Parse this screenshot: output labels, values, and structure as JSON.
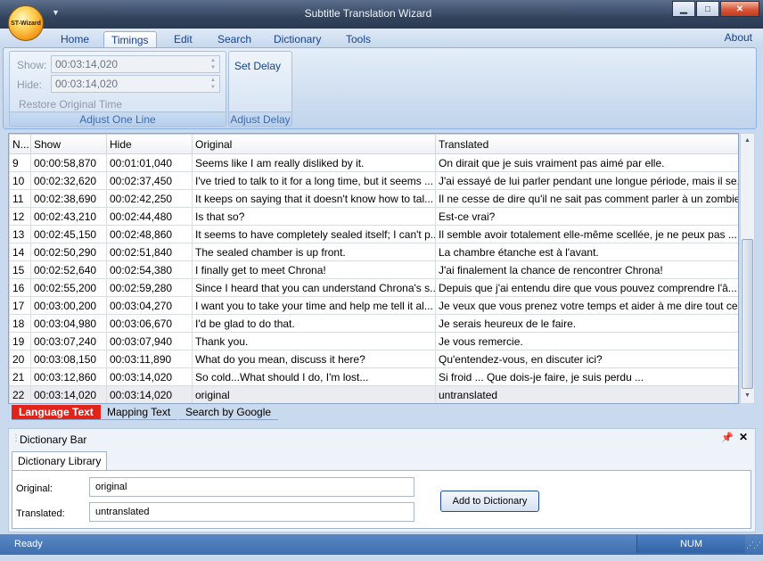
{
  "window": {
    "title": "Subtitle Translation Wizard",
    "orb_label": "ST-Wizard",
    "minimize": "▁",
    "maximize": "□",
    "close": "✕"
  },
  "ribbon_tabs": [
    "Home",
    "Timings",
    "Edit",
    "Search",
    "Dictionary",
    "Tools"
  ],
  "active_tab": "Timings",
  "about_label": "About",
  "adjust_one_line": {
    "show_label": "Show:",
    "show_value": "00:03:14,020",
    "hide_label": "Hide:",
    "hide_value": "00:03:14,020",
    "restore_label": "Restore Original Time",
    "group_label": "Adjust One Line"
  },
  "adjust_delay": {
    "set_delay_label": "Set Delay",
    "group_label": "Adjust Delay"
  },
  "grid": {
    "columns": [
      "N...",
      "Show",
      "Hide",
      "Original",
      "Translated"
    ],
    "rows": [
      [
        "9",
        "00:00:58,870",
        "00:01:01,040",
        "Seems like I am really disliked by it.",
        "On dirait que je suis vraiment pas aimé par elle."
      ],
      [
        "10",
        "00:02:32,620",
        "00:02:37,450",
        "I've tried to talk to it for a long time, but it seems ...",
        "J'ai essayé de lui parler pendant une longue période, mais il se..."
      ],
      [
        "11",
        "00:02:38,690",
        "00:02:42,250",
        "It keeps on saying that it doesn't know how to tal...",
        "Il ne cesse de dire qu'il ne sait pas comment parler à un zombie."
      ],
      [
        "12",
        "00:02:43,210",
        "00:02:44,480",
        "Is that so?",
        "Est-ce vrai?"
      ],
      [
        "13",
        "00:02:45,150",
        "00:02:48,860",
        "It seems to have completely sealed itself; I can't p...",
        "Il semble avoir totalement elle-même scellée, je ne peux pas ..."
      ],
      [
        "14",
        "00:02:50,290",
        "00:02:51,840",
        "The sealed chamber is up front.",
        "La chambre étanche est à l'avant."
      ],
      [
        "15",
        "00:02:52,640",
        "00:02:54,380",
        "I finally get to meet Chrona!",
        "J'ai finalement la chance de rencontrer Chrona!"
      ],
      [
        "16",
        "00:02:55,200",
        "00:02:59,280",
        "Since I heard that you can understand Chrona's s...",
        "Depuis que j'ai entendu dire que vous pouvez comprendre l'â..."
      ],
      [
        "17",
        "00:03:00,200",
        "00:03:04,270",
        "I want you to take your time and help me tell it al...",
        "Je veux que vous prenez votre temps et aider à me dire tout ce..."
      ],
      [
        "18",
        "00:03:04,980",
        "00:03:06,670",
        "I'd be glad to do that.",
        "Je serais heureux de le faire."
      ],
      [
        "19",
        "00:03:07,240",
        "00:03:07,940",
        "Thank you.",
        "Je vous remercie."
      ],
      [
        "20",
        "00:03:08,150",
        "00:03:11,890",
        "What do you mean, discuss it here?",
        "Qu'entendez-vous, en discuter ici?"
      ],
      [
        "21",
        "00:03:12,860",
        "00:03:14,020",
        "So cold...What should I do, I'm lost...",
        "Si froid ... Que dois-je faire, je suis perdu ..."
      ],
      [
        "22",
        "00:03:14,020",
        "00:03:14,020",
        "original",
        "untranslated"
      ]
    ]
  },
  "sheet_tabs": [
    "Language Text",
    "Mapping Text",
    "Search by Google"
  ],
  "dictionary_bar": {
    "title": "Dictionary Bar",
    "tab_label": "Dictionary Library",
    "original_label": "Original:",
    "original_value": "original",
    "translated_label": "Translated:",
    "translated_value": "untranslated",
    "add_button": "Add to Dictionary"
  },
  "status": {
    "ready": "Ready",
    "num": "NUM"
  }
}
